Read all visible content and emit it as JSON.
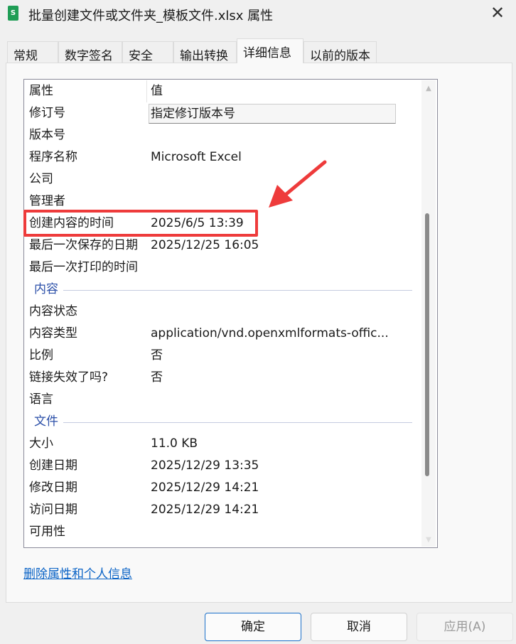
{
  "window": {
    "title": "批量创建文件或文件夹_模板文件.xlsx 属性",
    "file_icon_letter": "S"
  },
  "tabs": [
    "常规",
    "数字签名",
    "安全",
    "输出转换",
    "详细信息",
    "以前的版本"
  ],
  "active_tab": "详细信息",
  "header": {
    "property": "属性",
    "value": "值"
  },
  "rows": [
    {
      "k": "修订号",
      "v": "指定修订版本号"
    },
    {
      "k": "版本号",
      "v": ""
    },
    {
      "k": "程序名称",
      "v": "Microsoft Excel"
    },
    {
      "k": "公司",
      "v": ""
    },
    {
      "k": "管理者",
      "v": ""
    },
    {
      "k": "创建内容的时间",
      "v": "2025/6/5 13:39"
    },
    {
      "k": "最后一次保存的日期",
      "v": "2025/12/25 16:05"
    },
    {
      "k": "最后一次打印的时间",
      "v": ""
    },
    {
      "section": "内容"
    },
    {
      "k": "内容状态",
      "v": ""
    },
    {
      "k": "内容类型",
      "v": "application/vnd.openxmlformats-offic..."
    },
    {
      "k": "比例",
      "v": "否"
    },
    {
      "k": "链接失效了吗?",
      "v": "否"
    },
    {
      "k": "语言",
      "v": ""
    },
    {
      "section": "文件"
    },
    {
      "k": "大小",
      "v": "11.0 KB"
    },
    {
      "k": "创建日期",
      "v": "2025/12/29 13:35"
    },
    {
      "k": "修改日期",
      "v": "2025/12/29 14:21"
    },
    {
      "k": "访问日期",
      "v": "2025/12/29 14:21"
    },
    {
      "k": "可用性",
      "v": ""
    }
  ],
  "link": "删除属性和个人信息",
  "buttons": {
    "ok": "确定",
    "cancel": "取消",
    "apply": "应用(A)"
  },
  "colors": {
    "highlight": "#ee3b3b",
    "link": "#0a63c6"
  }
}
